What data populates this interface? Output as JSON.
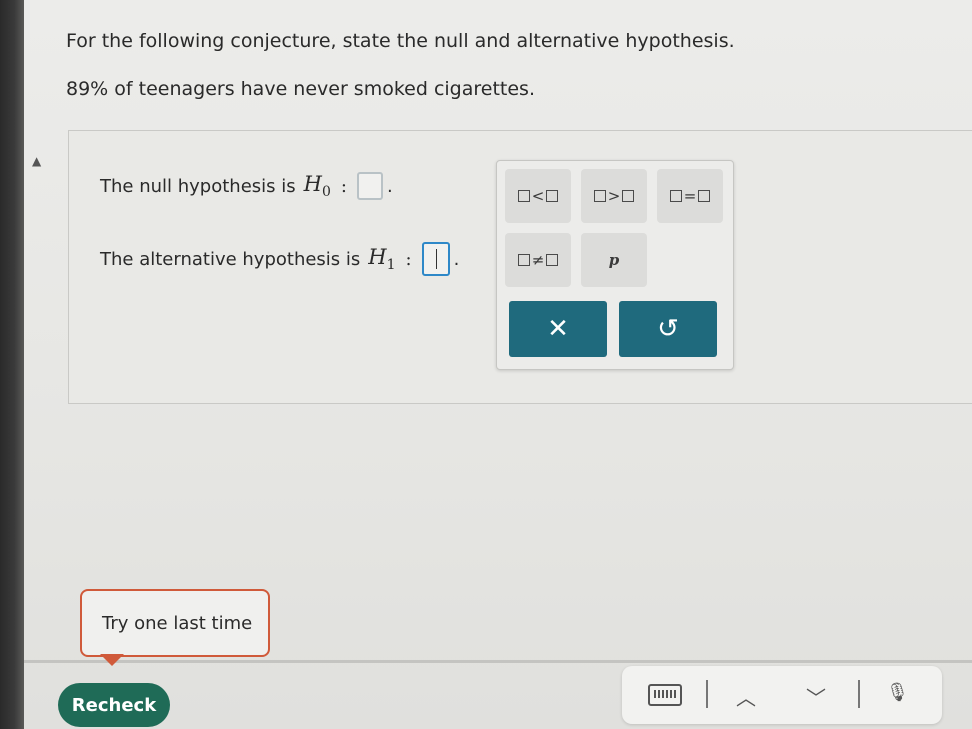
{
  "question": {
    "prompt": "For the following conjecture, state the null and alternative hypothesis.",
    "statement": "89% of teenagers have never smoked cigarettes."
  },
  "answer": {
    "null_label": "The null hypothesis is",
    "null_symbol": "H",
    "null_subscript": "0",
    "alt_label": "The alternative hypothesis is",
    "alt_symbol": "H",
    "alt_subscript": "1",
    "colon": ":",
    "period": "."
  },
  "palette": {
    "less_than": "<",
    "greater_than": ">",
    "equals": "=",
    "not_equal": "≠",
    "p_label": "p",
    "clear_label": "✕",
    "undo_label": "↺"
  },
  "feedback": {
    "tooltip": "Try one last time"
  },
  "footer": {
    "recheck_label": "Recheck",
    "sep": "|",
    "up": "︿",
    "down": "﹀",
    "mic": "🎙"
  },
  "colors": {
    "action_button": "#1f6a7d",
    "recheck_button": "#1f6b57",
    "tooltip_border": "#d05a3a",
    "active_slot_border": "#2e88c8"
  }
}
